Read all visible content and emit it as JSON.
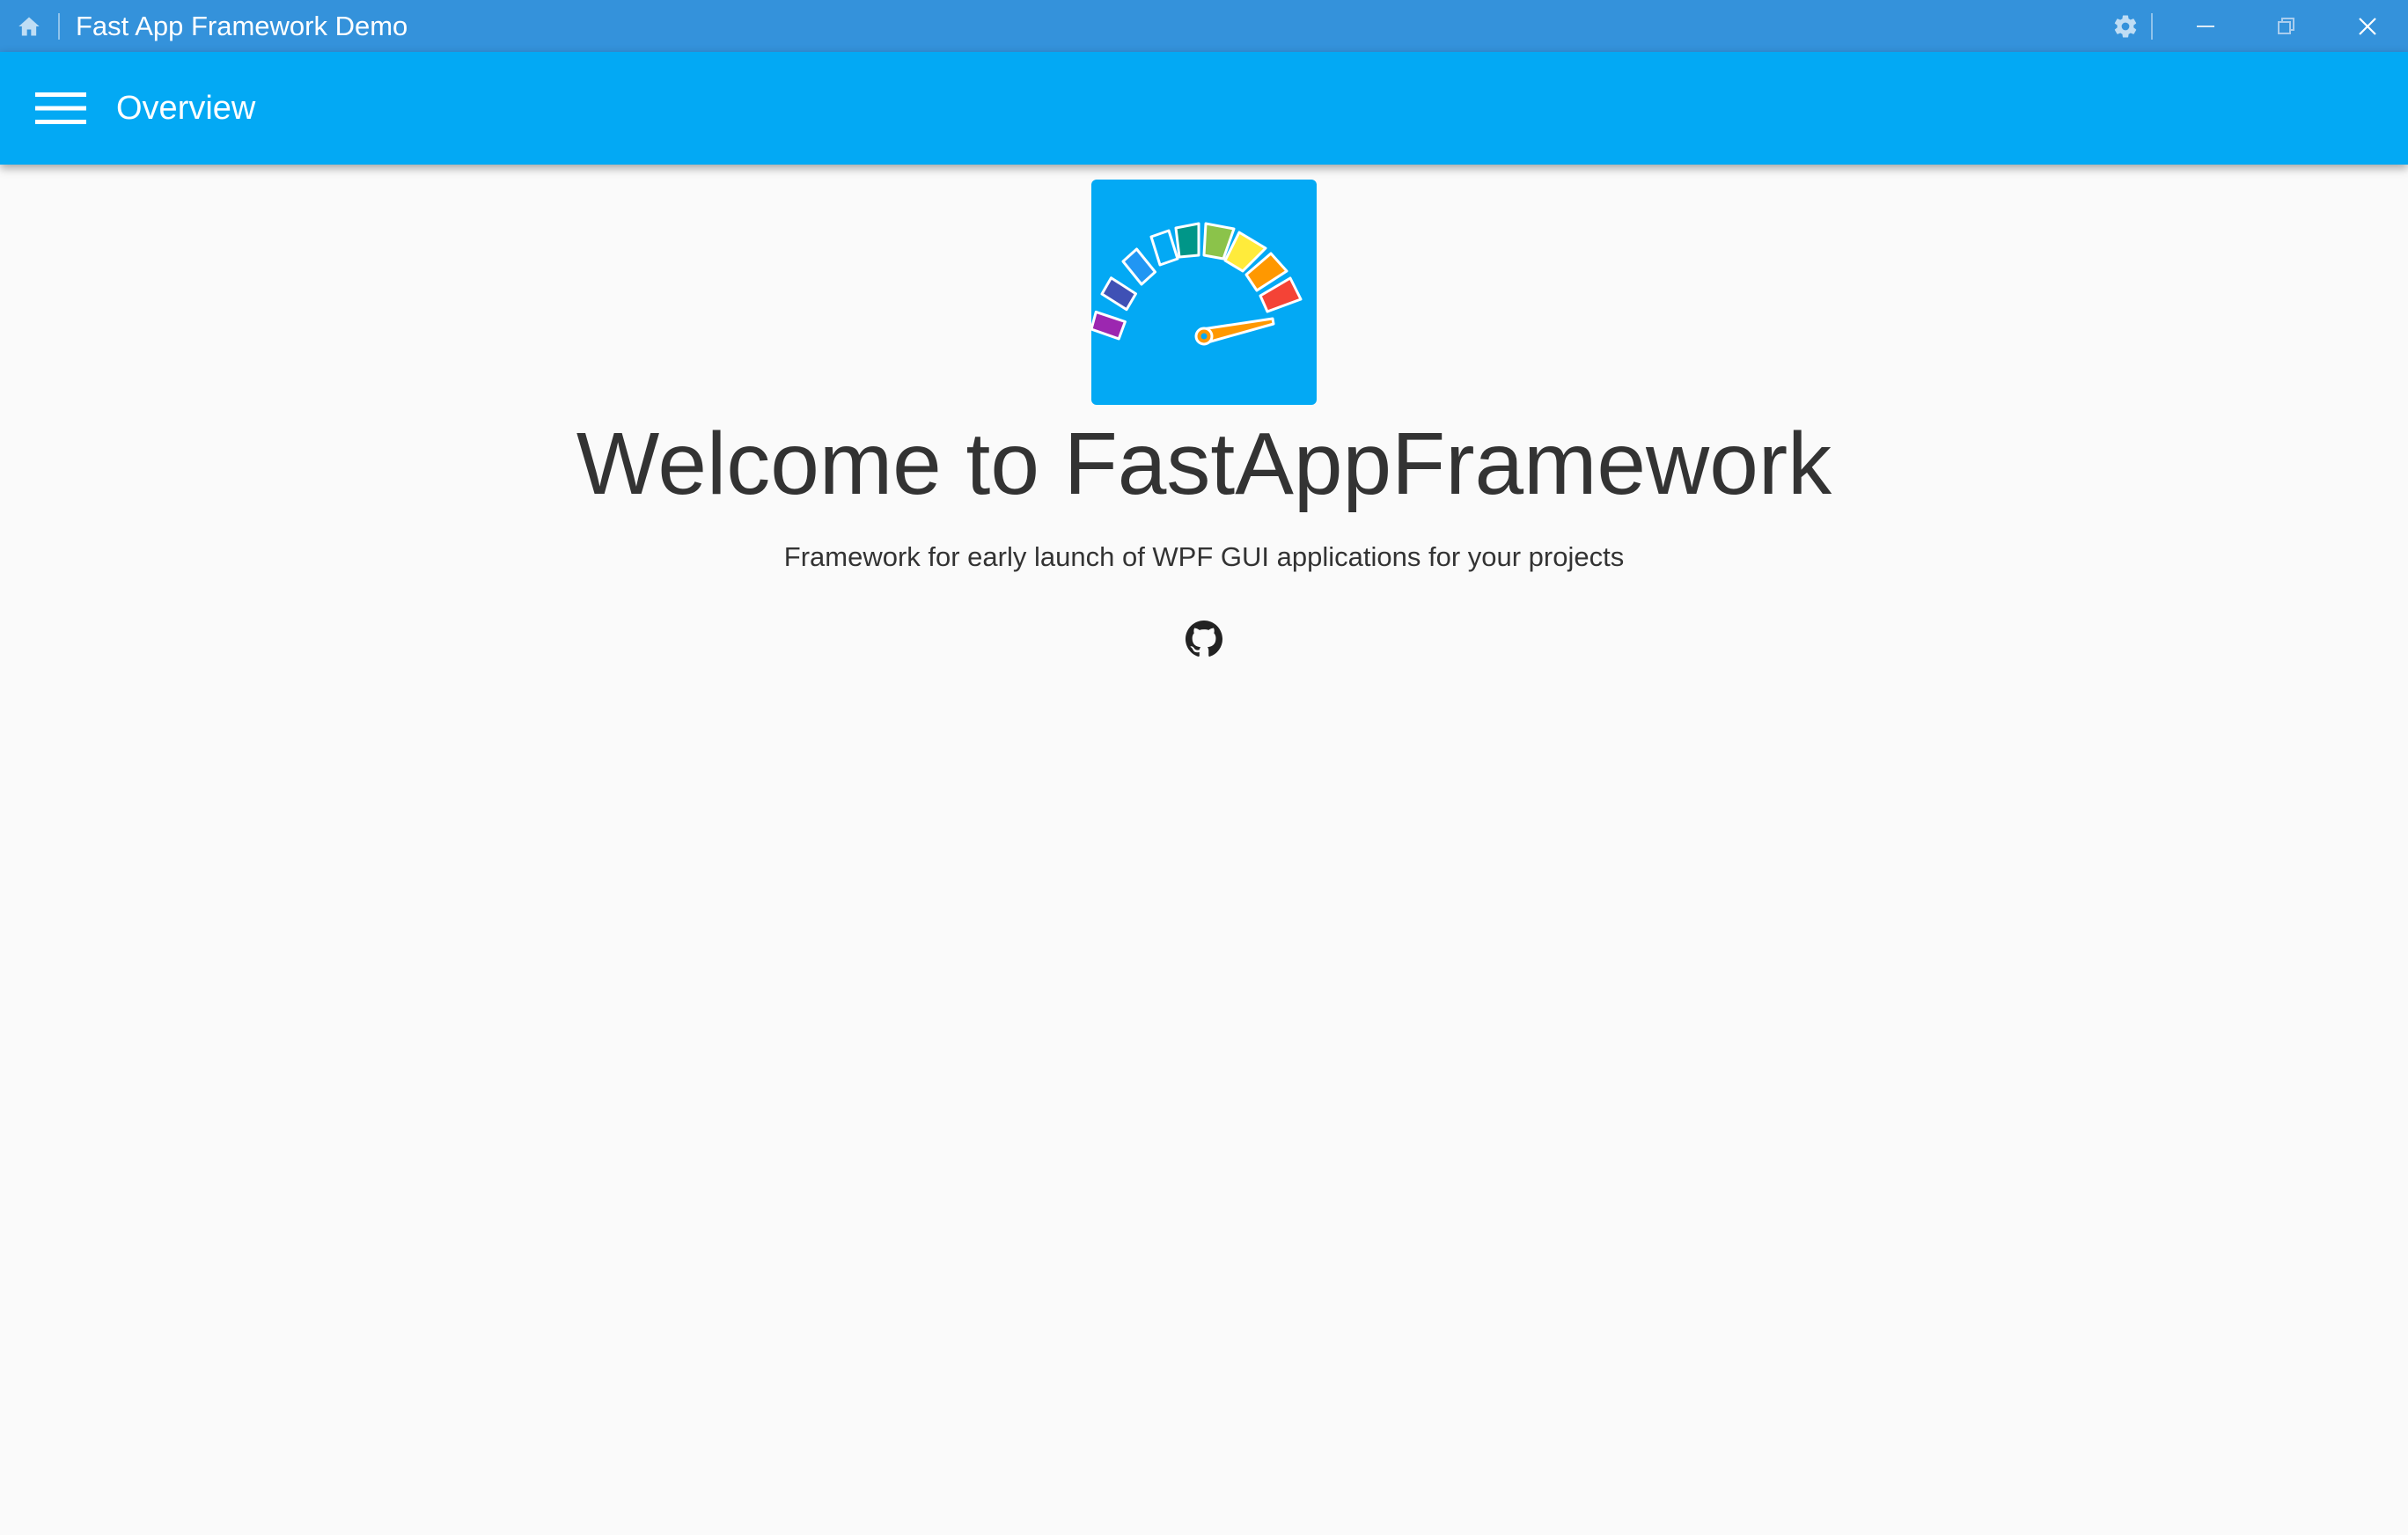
{
  "titlebar": {
    "title": "Fast App Framework Demo",
    "home_icon": "home-icon",
    "settings_icon": "gear-icon",
    "minimize_icon": "minimize-icon",
    "restore_icon": "restore-icon",
    "close_icon": "close-icon"
  },
  "appbar": {
    "menu_icon": "hamburger-menu-icon",
    "title": "Overview"
  },
  "main": {
    "logo": "speedometer-logo",
    "heading": "Welcome to FastAppFramework",
    "subtitle": "Framework for early launch of WPF GUI applications for your projects",
    "link_icon": "github-icon"
  },
  "colors": {
    "titlebar": "#3492DB",
    "appbar": "#03A9F4",
    "background": "#FAFAFA",
    "text": "#333333"
  }
}
